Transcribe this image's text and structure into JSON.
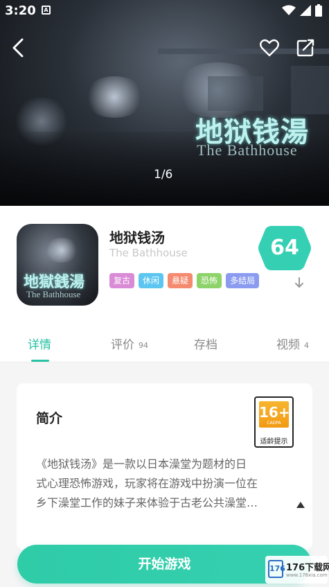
{
  "status_bar": {
    "time": "3:20",
    "notification_glyph": "A"
  },
  "hero": {
    "title": "地狱钱湯",
    "subtitle": "The Bathhouse",
    "counter": "1/6"
  },
  "game": {
    "name": "地狱钱汤",
    "english_name": "The Bathhouse",
    "icon_title": "地獄銭湯",
    "icon_subtitle": "The Bathhouse",
    "score": "64",
    "tags": [
      {
        "label": "复古",
        "color": "#d98bd6"
      },
      {
        "label": "休闲",
        "color": "#5cc6f0"
      },
      {
        "label": "悬疑",
        "color": "#f58a6e"
      },
      {
        "label": "恐怖",
        "color": "#8ed36a"
      },
      {
        "label": "多结局",
        "color": "#8b9cf0"
      }
    ]
  },
  "tabs": [
    {
      "label": "详情",
      "count": ""
    },
    {
      "label": "评价",
      "count": "94"
    },
    {
      "label": "存档",
      "count": ""
    },
    {
      "label": "视频",
      "count": "4"
    }
  ],
  "intro": {
    "title": "简介",
    "age_rating": "16+",
    "age_org": "CADPA",
    "age_hint": "适龄提示",
    "lines": [
      "《地狱钱汤》是一款以日本澡堂为题材的日",
      "式心理恐怖游戏，玩家将在游戏中扮演一位在",
      "乡下澡堂工作的妹子来体验于古老公共澡堂…"
    ]
  },
  "start_button": {
    "label": "开始游戏"
  },
  "watermark": {
    "logo": "176",
    "text": "176下载网",
    "sub": "www.176xia.com"
  },
  "colors": {
    "accent": "#27c2a3",
    "score_bg": "#35d0b4"
  },
  "icons": [
    "back-arrow-icon",
    "heart-icon",
    "share-icon",
    "expand-icon",
    "collapse-icon",
    "wifi-icon",
    "signal-icon",
    "battery-icon"
  ]
}
